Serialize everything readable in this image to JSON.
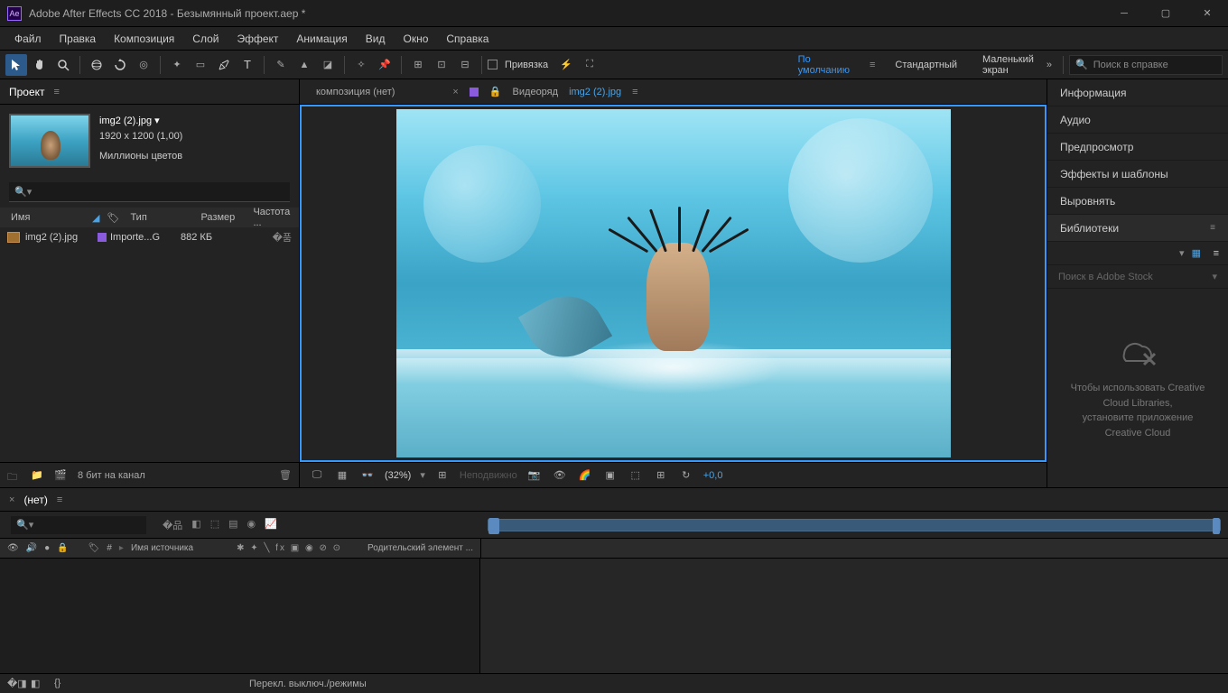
{
  "titlebar": {
    "app": "Ae",
    "title": "Adobe After Effects CC 2018 - Безымянный проект.aep *"
  },
  "menubar": [
    "Файл",
    "Правка",
    "Композиция",
    "Слой",
    "Эффект",
    "Анимация",
    "Вид",
    "Окно",
    "Справка"
  ],
  "toolbar": {
    "snap_label": "Привязка",
    "workspaces": [
      "По умолчанию",
      "Стандартный",
      "Маленький экран"
    ],
    "search_placeholder": "Поиск в справке"
  },
  "project": {
    "tab": "Проект",
    "file": {
      "name": "img2 (2).jpg ▾",
      "dims": "1920 x 1200 (1,00)",
      "colors": "Миллионы цветов"
    },
    "cols": {
      "name": "Имя",
      "type": "Тип",
      "size": "Размер",
      "freq": "Частота ..."
    },
    "row": {
      "name": "img2 (2).jpg",
      "type": "Importe...G",
      "size": "882 КБ"
    },
    "bpc": "8 бит на канал"
  },
  "viewer": {
    "tab_comp": "композиция (нет)",
    "tab_layer": "Видеоряд",
    "tab_file": "img2 (2).jpg",
    "zoom": "(32%)",
    "still": "Неподвижно",
    "timecode": "+0,0"
  },
  "right": {
    "panels": [
      "Информация",
      "Аудио",
      "Предпросмотр",
      "Эффекты и шаблоны",
      "Выровнять",
      "Библиотеки"
    ],
    "lib_search": "Поиск в Adobe Stock",
    "lib_empty1": "Чтобы использовать Creative Cloud Libraries,",
    "lib_empty2": "установите приложение Creative Cloud"
  },
  "timeline": {
    "tab": "(нет)",
    "col_num": "#",
    "col_src": "Имя источника",
    "col_parent": "Родительский элемент ...",
    "footer_toggle": "Перекл. выключ./режимы"
  }
}
